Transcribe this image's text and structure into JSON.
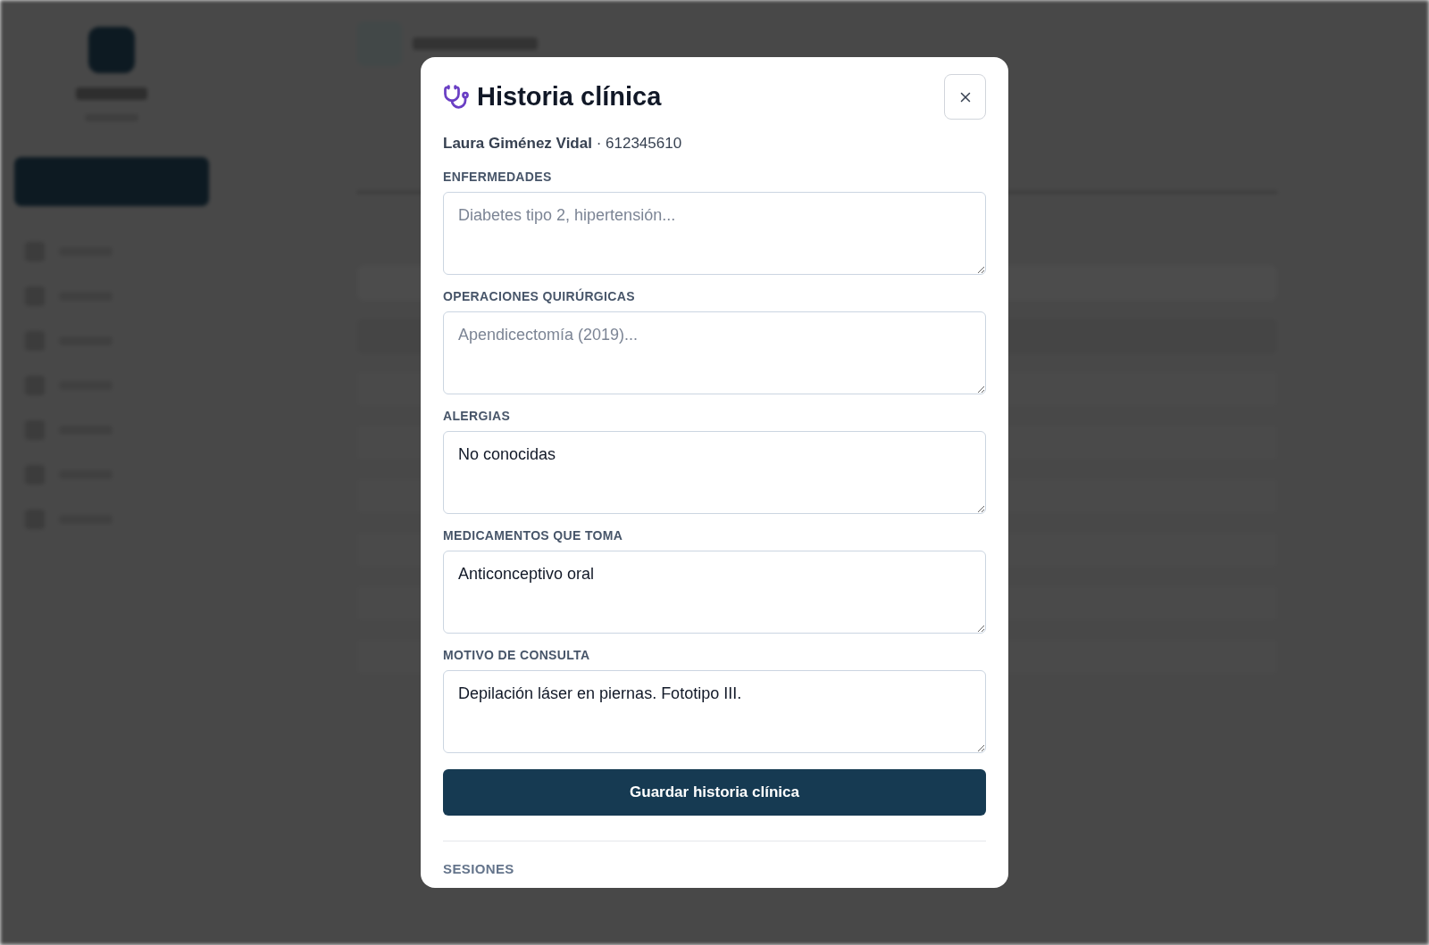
{
  "dialog": {
    "title": "Historia clínica",
    "patient_line": "**Laura Giménez Vidal** · 612345610",
    "fields": [
      {
        "label": "ENFERMEDADES",
        "placeholder": "Diabetes tipo 2, hipertensión..."
      },
      {
        "label": "OPERACIONES QUIRÚRGICAS",
        "placeholder": "Apendicectomía (2019)..."
      },
      {
        "label": "ALERGIAS",
        "value": "No conocidas"
      },
      {
        "label": "MEDICAMENTOS QUE TOMA",
        "value": "Anticonceptivo oral"
      },
      {
        "label": "MOTIVO DE CONSULTA",
        "value": "Depilación láser en piernas. Fototipo III."
      }
    ],
    "save_button": "Guardar historia clínica",
    "next_section": "SESIONES"
  }
}
